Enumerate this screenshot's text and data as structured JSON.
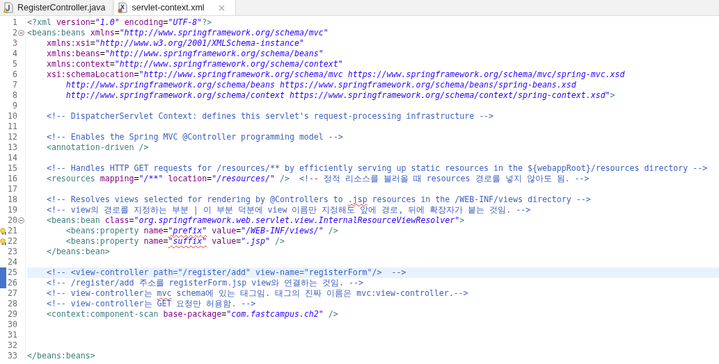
{
  "tabs": [
    {
      "label": "RegisterController.java",
      "kind": "java",
      "selected": false
    },
    {
      "label": "servlet-context.xml",
      "kind": "xml",
      "selected": true
    }
  ],
  "editor": {
    "lines": [
      {
        "number": "1",
        "current": false,
        "tokens": [
          {
            "kind": "tag",
            "text": "<?xml "
          },
          {
            "kind": "attr",
            "text": "version"
          },
          {
            "kind": "plain",
            "text": "="
          },
          {
            "kind": "value",
            "text": "\"1.0\""
          },
          {
            "kind": "attr",
            "text": " encoding"
          },
          {
            "kind": "plain",
            "text": "="
          },
          {
            "kind": "value",
            "text": "\"UTF-8\""
          },
          {
            "kind": "tag",
            "text": "?>"
          }
        ]
      },
      {
        "number": "2",
        "current": false,
        "markers": [
          {
            "kind": "fold"
          }
        ],
        "tokens": [
          {
            "kind": "tag",
            "text": "<beans:beans "
          },
          {
            "kind": "attr",
            "text": "xmlns"
          },
          {
            "kind": "plain",
            "text": "="
          },
          {
            "kind": "value",
            "text": "\"http://www.springframework.org/schema/mvc\""
          }
        ]
      },
      {
        "number": "3",
        "current": false,
        "tokens": [
          {
            "kind": "attr",
            "text": "    xmlns:xsi"
          },
          {
            "kind": "plain",
            "text": "="
          },
          {
            "kind": "value",
            "text": "\"http://www.w3.org/2001/XMLSchema-instance\""
          }
        ]
      },
      {
        "number": "4",
        "current": false,
        "tokens": [
          {
            "kind": "attr",
            "text": "    xmlns:beans"
          },
          {
            "kind": "plain",
            "text": "="
          },
          {
            "kind": "value",
            "text": "\"http://www.springframework.org/schema/beans\""
          }
        ]
      },
      {
        "number": "5",
        "current": false,
        "tokens": [
          {
            "kind": "attr",
            "text": "    xmlns:context"
          },
          {
            "kind": "plain",
            "text": "="
          },
          {
            "kind": "value",
            "text": "\"http://www.springframework.org/schema/context\""
          }
        ]
      },
      {
        "number": "6",
        "current": false,
        "tokens": [
          {
            "kind": "attr",
            "text": "    xsi:schemaLocation"
          },
          {
            "kind": "plain",
            "text": "="
          },
          {
            "kind": "value",
            "text": "\"http://www.springframework.org/schema/mvc https://www.springframework.org/schema/mvc/spring-mvc.xsd"
          }
        ]
      },
      {
        "number": "7",
        "current": false,
        "tokens": [
          {
            "kind": "value",
            "text": "        http://www.springframework.org/schema/beans https://www.springframework.org/schema/beans/spring-beans.xsd"
          }
        ]
      },
      {
        "number": "8",
        "current": false,
        "tokens": [
          {
            "kind": "value",
            "text": "        http://www.springframework.org/schema/context https://www.springframework.org/schema/context/spring-context.xsd\""
          },
          {
            "kind": "tag",
            "text": ">"
          }
        ]
      },
      {
        "number": "9",
        "current": false
      },
      {
        "number": "10",
        "current": false,
        "tokens": [
          {
            "kind": "comment",
            "text": "    <!-- DispatcherServlet Context: defines this servlet's request-processing infrastructure -->"
          }
        ]
      },
      {
        "number": "11",
        "current": false
      },
      {
        "number": "12",
        "current": false,
        "tokens": [
          {
            "kind": "comment",
            "text": "    <!-- Enables the Spring MVC @Controller programming model -->"
          }
        ]
      },
      {
        "number": "13",
        "current": false,
        "tokens": [
          {
            "kind": "tag",
            "text": "    <annotation-driven />"
          }
        ]
      },
      {
        "number": "14",
        "current": false
      },
      {
        "number": "15",
        "current": false,
        "tokens": [
          {
            "kind": "comment",
            "text": "    <!-- Handles HTTP GET requests for /resources/** by efficiently serving up static resources in the ${webappRoot}/resources directory -->"
          }
        ]
      },
      {
        "number": "16",
        "current": false,
        "tokens": [
          {
            "kind": "tag",
            "text": "    <resources "
          },
          {
            "kind": "attr",
            "text": "mapping"
          },
          {
            "kind": "plain",
            "text": "="
          },
          {
            "kind": "value",
            "text": "\"/**\""
          },
          {
            "kind": "attr",
            "text": " location"
          },
          {
            "kind": "plain",
            "text": "="
          },
          {
            "kind": "value",
            "text": "\"/resources/\""
          },
          {
            "kind": "tag",
            "text": " />"
          },
          {
            "kind": "comment",
            "text": "  <!-- 정적 리소스를 불러올 때 resources 경로를 넣지 않아도 됨. -->"
          }
        ]
      },
      {
        "number": "17",
        "current": false
      },
      {
        "number": "18",
        "current": false,
        "tokens": [
          {
            "kind": "comment",
            "text": "    <!-- Resolves views selected for rendering by @Controllers to "
          },
          {
            "kind": "typocomment",
            "text": ".jsp"
          },
          {
            "kind": "comment",
            "text": " resources in the /WEB-INF/views directory -->"
          }
        ]
      },
      {
        "number": "19",
        "current": false,
        "tokens": [
          {
            "kind": "comment",
            "text": "    <!-- view의 경로를 지정하는 부분 | 이 부분 덕분에 view 이름만 지정해도 앞에 경로, 뒤에 확장자가 붙는 것임. -->"
          }
        ]
      },
      {
        "number": "20",
        "current": false,
        "markers": [
          {
            "kind": "fold"
          }
        ],
        "tokens": [
          {
            "kind": "tag",
            "text": "    <beans:bean "
          },
          {
            "kind": "attr",
            "text": "class"
          },
          {
            "kind": "plain",
            "text": "="
          },
          {
            "kind": "value",
            "text": "\"org.springframework.web.servlet.view.InternalResourceViewResolver\""
          },
          {
            "kind": "tag",
            "text": ">"
          }
        ]
      },
      {
        "number": "21",
        "current": false,
        "markers": [
          {
            "kind": "hint"
          }
        ],
        "tokens": [
          {
            "kind": "tag",
            "text": "        <beans:property "
          },
          {
            "kind": "attr",
            "text": "name"
          },
          {
            "kind": "plain",
            "text": "="
          },
          {
            "kind": "typovalue",
            "text": "\"prefix\""
          },
          {
            "kind": "attr",
            "text": " value"
          },
          {
            "kind": "plain",
            "text": "="
          },
          {
            "kind": "value",
            "text": "\"/WEB-INF/views/\""
          },
          {
            "kind": "tag",
            "text": " />"
          }
        ]
      },
      {
        "number": "22",
        "current": false,
        "markers": [
          {
            "kind": "hint"
          }
        ],
        "tokens": [
          {
            "kind": "tag",
            "text": "        <beans:property "
          },
          {
            "kind": "attr",
            "text": "name"
          },
          {
            "kind": "plain",
            "text": "="
          },
          {
            "kind": "typovalue",
            "text": "\"suffix\""
          },
          {
            "kind": "attr",
            "text": " value"
          },
          {
            "kind": "plain",
            "text": "="
          },
          {
            "kind": "value",
            "text": "\".jsp\""
          },
          {
            "kind": "tag",
            "text": " />"
          }
        ]
      },
      {
        "number": "23",
        "current": false,
        "tokens": [
          {
            "kind": "tag",
            "text": "    </beans:bean>"
          }
        ]
      },
      {
        "number": "24",
        "current": false
      },
      {
        "number": "25",
        "current": true,
        "markers": [
          {
            "kind": "change"
          }
        ],
        "tokens": [
          {
            "kind": "comment",
            "text": "    <!-- <view-controller path=\"/register/add\" view-name=\"registerForm\"/>  -->"
          }
        ]
      },
      {
        "number": "26",
        "current": false,
        "markers": [
          {
            "kind": "change"
          }
        ],
        "tokens": [
          {
            "kind": "comment",
            "text": "    <!-- /register/add 주소를 registerForm.jsp view와 연결하는 것임. -->"
          }
        ]
      },
      {
        "number": "27",
        "current": false,
        "tokens": [
          {
            "kind": "comment",
            "text": "    <!-- view-controller는 "
          },
          {
            "kind": "typocomment",
            "text": "mvc"
          },
          {
            "kind": "comment",
            "text": " schema에 있는 태그임. 태그의 진짜 이름은 mvc:view-controller.-->"
          }
        ]
      },
      {
        "number": "28",
        "current": false,
        "tokens": [
          {
            "kind": "comment",
            "text": "    <!-- view-controller는 GET 요청만 허용함. -->"
          }
        ]
      },
      {
        "number": "29",
        "current": false,
        "tokens": [
          {
            "kind": "tag",
            "text": "    <context:component-scan "
          },
          {
            "kind": "attr",
            "text": "base-package"
          },
          {
            "kind": "plain",
            "text": "="
          },
          {
            "kind": "value",
            "text": "\"com.fastcampus.ch2\""
          },
          {
            "kind": "tag",
            "text": " />"
          }
        ]
      },
      {
        "number": "30",
        "current": false
      },
      {
        "number": "31",
        "current": false
      },
      {
        "number": "32",
        "current": false
      },
      {
        "number": "33",
        "current": false,
        "tokens": [
          {
            "kind": "tag",
            "text": "</beans:beans>"
          }
        ]
      }
    ]
  }
}
